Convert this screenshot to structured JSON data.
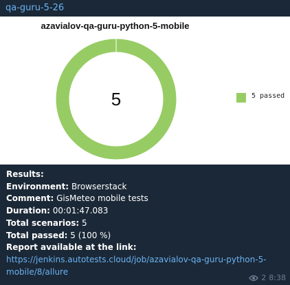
{
  "header": {
    "channel_name": "qa-guru-5-26"
  },
  "chart": {
    "title": "azavialov-qa-guru-python-5-mobile",
    "center_value": "5",
    "legend_label": "5 passed",
    "legend_color": "#97cc64",
    "ring_color": "#97cc64"
  },
  "chart_data": {
    "type": "pie",
    "title": "azavialov-qa-guru-python-5-mobile",
    "categories": [
      "passed"
    ],
    "values": [
      5
    ],
    "legend": [
      "5 passed"
    ],
    "legend_position": "right",
    "colors": [
      "#97cc64"
    ]
  },
  "message": {
    "results_label": "Results:",
    "environment_label": "Environment:",
    "environment_value": "Browserstack",
    "comment_label": "Comment:",
    "comment_value": "GisMeteo mobile tests",
    "duration_label": "Duration:",
    "duration_value": "00:01:47.083",
    "scenarios_label": "Total scenarios:",
    "scenarios_value": "5",
    "passed_label": "Total passed:",
    "passed_value": "5 (100 %)",
    "report_label": "Report available at the link:",
    "report_link": "https://jenkins.autotests.cloud/job/azavialov-qa-guru-python-5-mobile/8/allure"
  },
  "meta": {
    "views": "2",
    "time": "8:38",
    "eye_icon": "eye-icon"
  }
}
